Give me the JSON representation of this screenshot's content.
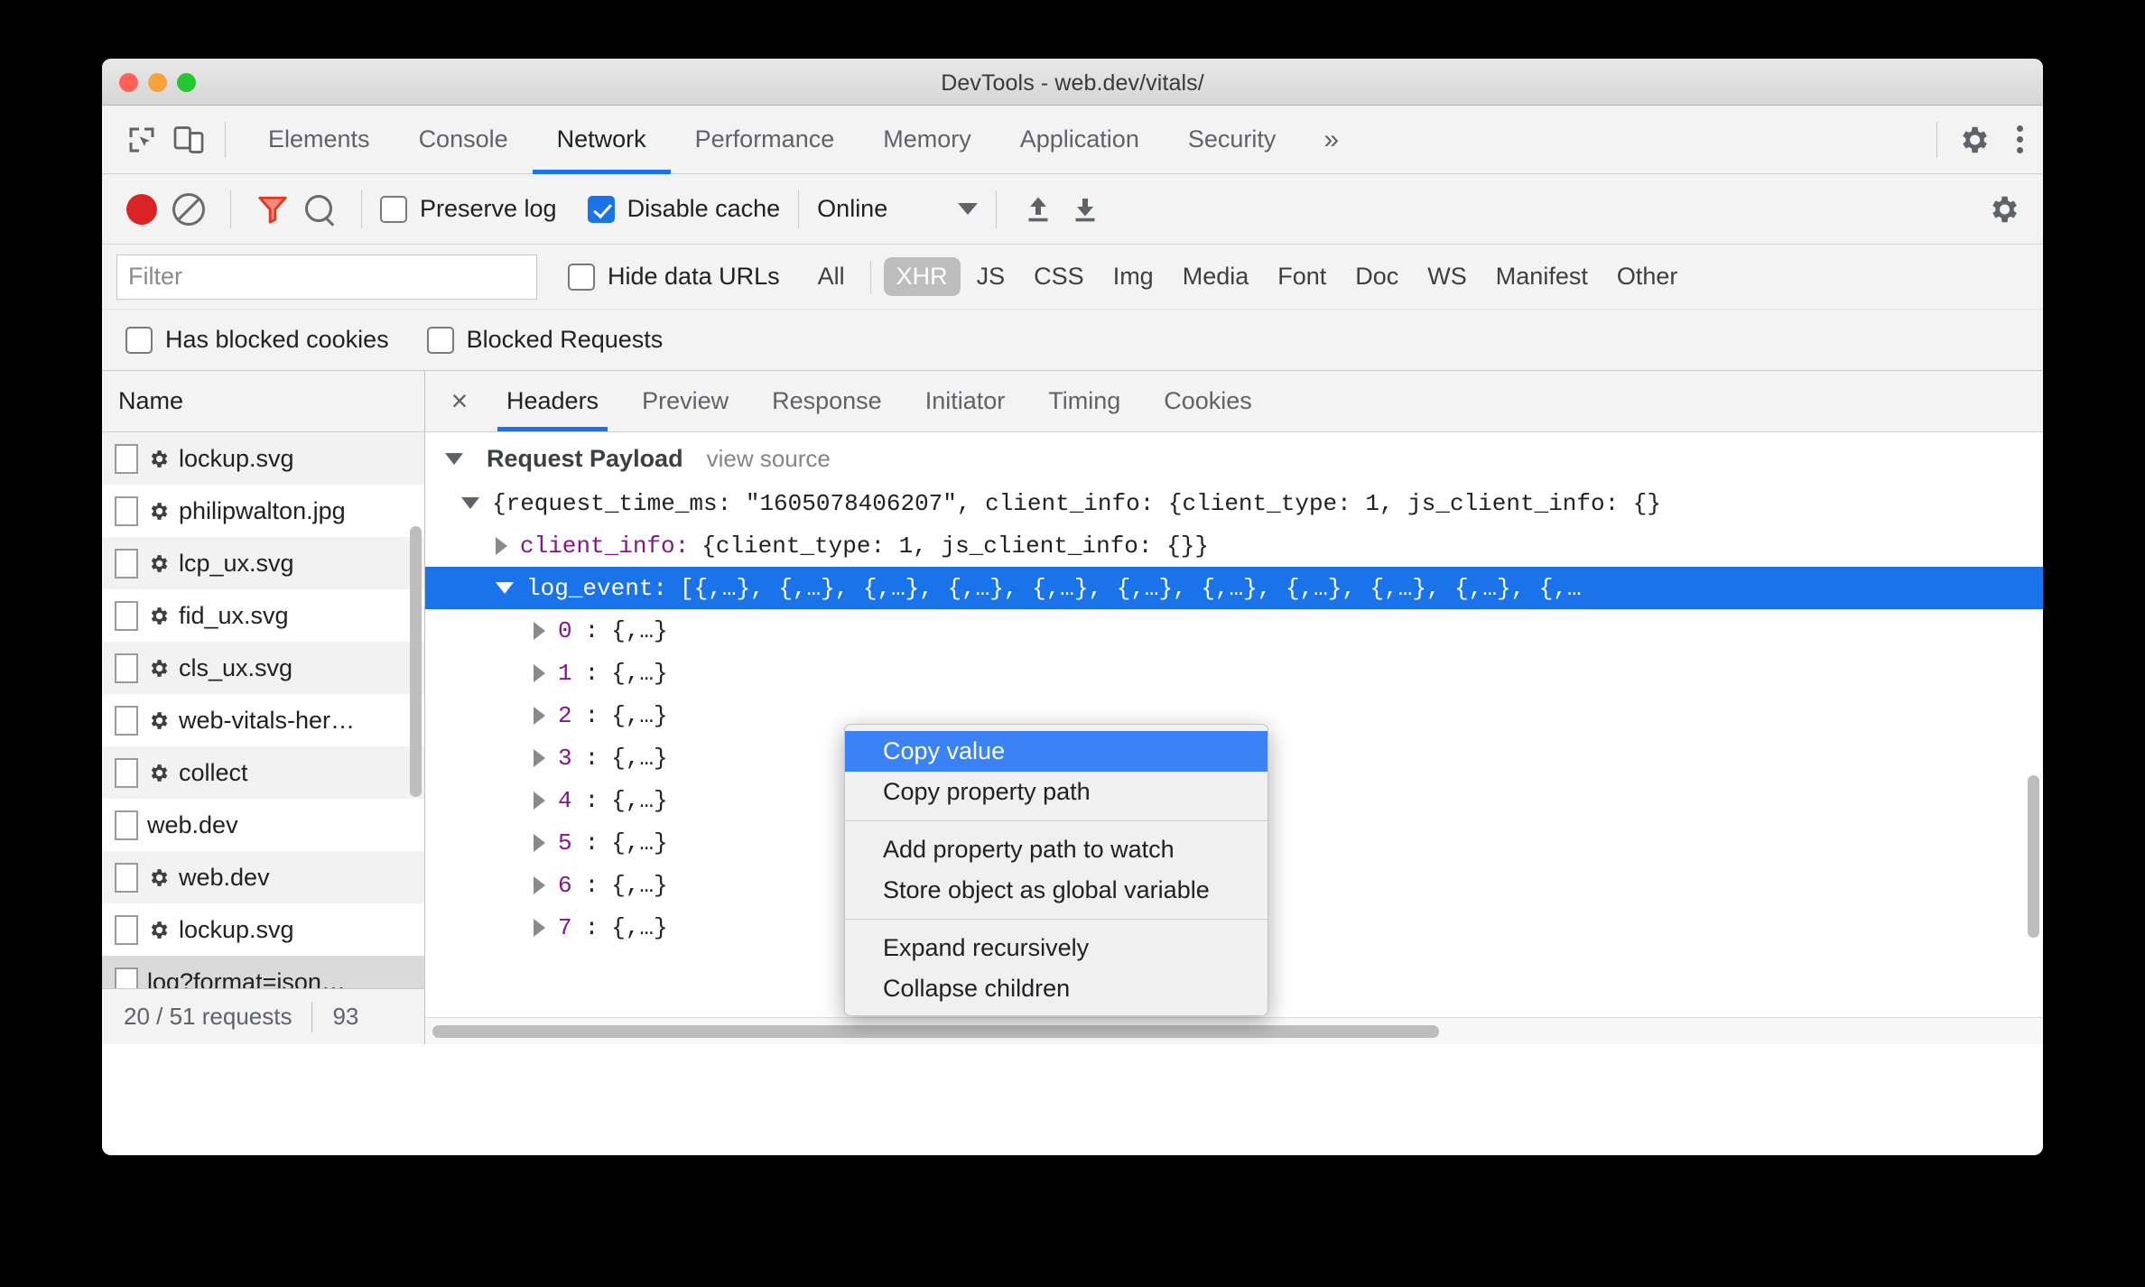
{
  "window": {
    "title": "DevTools - web.dev/vitals/"
  },
  "main_tabs": {
    "inspect_icon": "inspect-cursor-icon",
    "device_icon": "device-toolbar-icon",
    "items": [
      {
        "label": "Elements",
        "active": false
      },
      {
        "label": "Console",
        "active": false
      },
      {
        "label": "Network",
        "active": true
      },
      {
        "label": "Performance",
        "active": false
      },
      {
        "label": "Memory",
        "active": false
      },
      {
        "label": "Application",
        "active": false
      },
      {
        "label": "Security",
        "active": false
      }
    ],
    "overflow_label": "»",
    "settings_icon": "gear-icon",
    "more_icon": "kebab-menu-icon"
  },
  "network_toolbar": {
    "record_icon": "record-button-icon",
    "clear_icon": "clear-icon",
    "filter_icon": "funnel-filter-icon",
    "search_icon": "search-icon",
    "preserve_log_label": "Preserve log",
    "preserve_log_checked": false,
    "disable_cache_label": "Disable cache",
    "disable_cache_checked": true,
    "throttle_value": "Online",
    "import_icon": "upload-har-icon",
    "export_icon": "download-har-icon",
    "settings_icon": "gear-icon"
  },
  "filter_row": {
    "filter_placeholder": "Filter",
    "filter_value": "",
    "hide_data_urls_label": "Hide data URLs",
    "hide_data_urls_checked": false,
    "types": [
      {
        "label": "All",
        "active": false
      },
      {
        "label": "XHR",
        "active": true
      },
      {
        "label": "JS",
        "active": false
      },
      {
        "label": "CSS",
        "active": false
      },
      {
        "label": "Img",
        "active": false
      },
      {
        "label": "Media",
        "active": false
      },
      {
        "label": "Font",
        "active": false
      },
      {
        "label": "Doc",
        "active": false
      },
      {
        "label": "WS",
        "active": false
      },
      {
        "label": "Manifest",
        "active": false
      },
      {
        "label": "Other",
        "active": false
      }
    ]
  },
  "blocked_row": {
    "has_blocked_cookies_label": "Has blocked cookies",
    "has_blocked_cookies_checked": false,
    "blocked_requests_label": "Blocked Requests",
    "blocked_requests_checked": false
  },
  "request_list": {
    "column_header": "Name",
    "rows": [
      {
        "name": "lockup.svg",
        "has_gear": true,
        "selected": false
      },
      {
        "name": "philipwalton.jpg",
        "has_gear": true,
        "selected": false
      },
      {
        "name": "lcp_ux.svg",
        "has_gear": true,
        "selected": false
      },
      {
        "name": "fid_ux.svg",
        "has_gear": true,
        "selected": false
      },
      {
        "name": "cls_ux.svg",
        "has_gear": true,
        "selected": false
      },
      {
        "name": "web-vitals-her…",
        "has_gear": true,
        "selected": false
      },
      {
        "name": "collect",
        "has_gear": true,
        "selected": false
      },
      {
        "name": "web.dev",
        "has_gear": false,
        "selected": false
      },
      {
        "name": "web.dev",
        "has_gear": true,
        "selected": false
      },
      {
        "name": "lockup.svg",
        "has_gear": true,
        "selected": false
      },
      {
        "name": "log?format=json…",
        "has_gear": false,
        "selected": true
      }
    ],
    "footer_requests": "20 / 51 requests",
    "footer_transferred": "93"
  },
  "detail_panel": {
    "close_icon": "close-icon",
    "tabs": [
      {
        "label": "Headers",
        "active": true
      },
      {
        "label": "Preview",
        "active": false
      },
      {
        "label": "Response",
        "active": false
      },
      {
        "label": "Initiator",
        "active": false
      },
      {
        "label": "Timing",
        "active": false
      },
      {
        "label": "Cookies",
        "active": false
      }
    ],
    "section_title": "Request Payload",
    "view_source_label": "view source",
    "root_line": "{request_time_ms: \"1605078406207\", client_info: {client_type: 1, js_client_info: {}",
    "client_info_key": "client_info:",
    "client_info_value": "{client_type: 1, js_client_info: {}}",
    "log_event_key": "log_event:",
    "log_event_value": "[{,…}, {,…}, {,…}, {,…}, {,…}, {,…}, {,…}, {,…}, {,…}, {,…}, {,…",
    "array_items": [
      {
        "index": "0",
        "value": "{,…}"
      },
      {
        "index": "1",
        "value": "{,…}"
      },
      {
        "index": "2",
        "value": "{,…}"
      },
      {
        "index": "3",
        "value": "{,…}"
      },
      {
        "index": "4",
        "value": "{,…}"
      },
      {
        "index": "5",
        "value": "{,…}"
      },
      {
        "index": "6",
        "value": "{,…}"
      },
      {
        "index": "7",
        "value": "{,…}"
      }
    ]
  },
  "context_menu": {
    "groups": [
      [
        {
          "label": "Copy value",
          "selected": true
        },
        {
          "label": "Copy property path",
          "selected": false
        }
      ],
      [
        {
          "label": "Add property path to watch",
          "selected": false
        },
        {
          "label": "Store object as global variable",
          "selected": false
        }
      ],
      [
        {
          "label": "Expand recursively",
          "selected": false
        },
        {
          "label": "Collapse children",
          "selected": false
        }
      ]
    ]
  },
  "colors": {
    "accent": "#1a73e8",
    "selection": "#1a73e8",
    "menu_selection": "#3b82f6",
    "record": "#da2424",
    "property_key": "#881391"
  }
}
